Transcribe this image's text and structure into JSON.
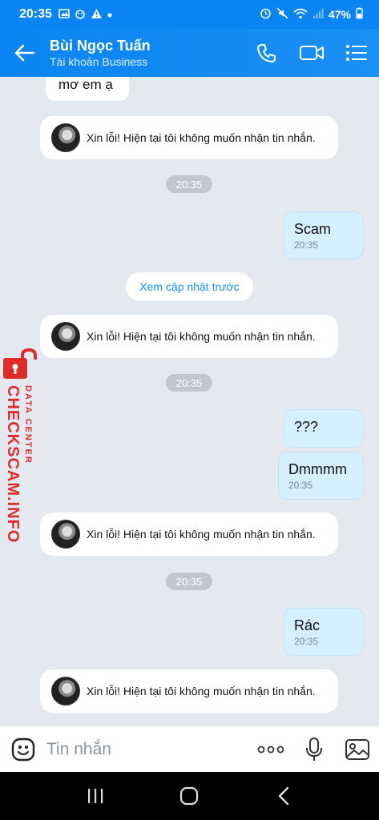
{
  "status": {
    "time": "20:35",
    "battery": "47%"
  },
  "header": {
    "name": "Bùi Ngọc Tuấn",
    "subtitle": "Tài khoản Business"
  },
  "messages": {
    "partial_top": "mơ em ạ",
    "system_text": "Xin lỗi! Hiện tại tôi không muốn nhận tin nhắn.",
    "time_chip": "20:35",
    "load_previous": "Xem cập nhật trước",
    "mine": [
      {
        "text": "Scam",
        "time": "20:35"
      },
      {
        "text": "???",
        "time": ""
      },
      {
        "text": "Dmmmm",
        "time": "20:35"
      },
      {
        "text": "Rác",
        "time": "20:35"
      }
    ]
  },
  "watermark": {
    "main": "CHECKSCAM.INFO",
    "sub": "DATA CENTER"
  },
  "input": {
    "placeholder": "Tin nhắn"
  },
  "colors": {
    "header": "#0a84f2",
    "my_bubble": "#d6efff",
    "background": "#e4e8ef",
    "watermark": "#e02b2b"
  }
}
